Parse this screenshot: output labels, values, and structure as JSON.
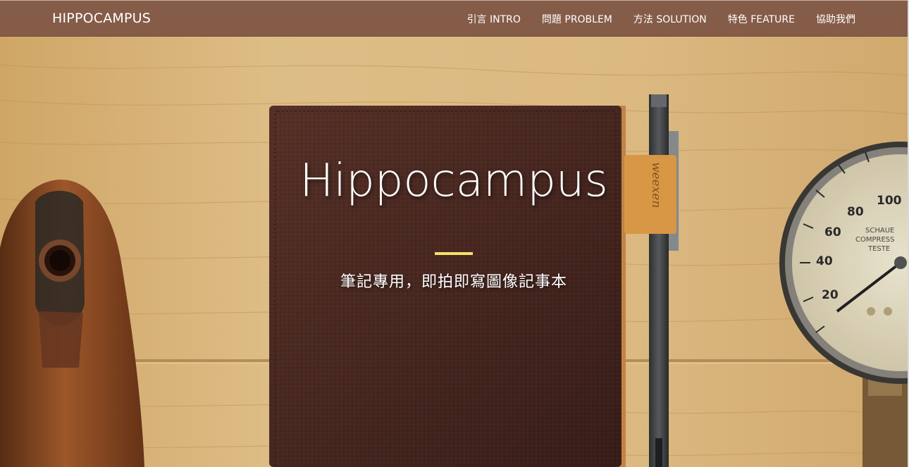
{
  "navbar": {
    "brand": "HIPPOCAMPUS",
    "items": [
      {
        "label": "引言 INTRO"
      },
      {
        "label": "問題 PROBLEM"
      },
      {
        "label": "方法 SOLUTION"
      },
      {
        "label": "特色 FEATURE"
      },
      {
        "label": "協助我們"
      }
    ]
  },
  "hero": {
    "title": "Hippocampus",
    "subtitle": "筆記專用，即拍即寫圖像記事本",
    "background_icons": [
      "wooden-shoe-last-icon",
      "leather-notebook-icon",
      "pencil-icon",
      "pressure-gauge-icon"
    ],
    "pencil_brand": "weexen",
    "gauge": {
      "brand_lines": [
        "SCHAUE",
        "COMPRESS",
        "TESTE"
      ],
      "scale_labels": [
        "20",
        "40",
        "60",
        "80",
        "100"
      ]
    }
  },
  "colors": {
    "navbar_bg": "#855c48",
    "accent_rule": "#f4e36a",
    "wood": "#e2bd7f",
    "leather": "#4a2a22"
  }
}
